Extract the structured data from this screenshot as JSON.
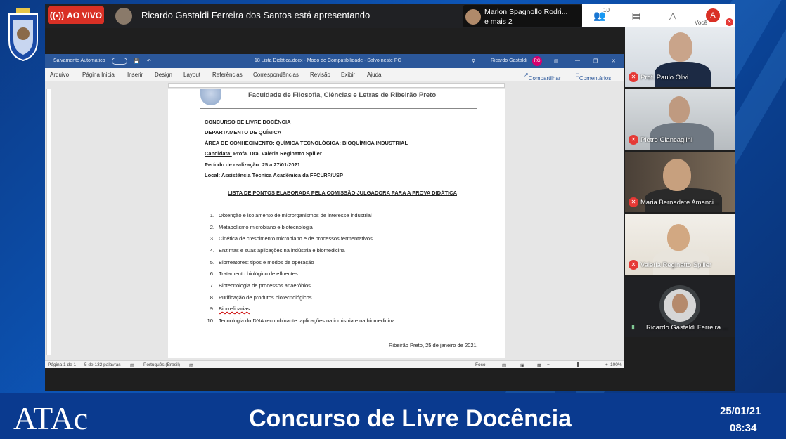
{
  "meet": {
    "live_badge": "AO VIVO",
    "presenter_text": "Ricardo Gastaldi Ferreira dos Santos está apresentando",
    "others_line1": "Marlon Spagnollo Rodri...",
    "others_line2": "e mais 2",
    "people_count": "10",
    "user_initial": "A",
    "you_label": "Você"
  },
  "word": {
    "autosave": "Salvamento Automático",
    "doc_title": "18 Lista Didática.docx  -  Modo de Compatibilidade  -  Salvo neste PC",
    "user_name": "Ricardo Gastaldi",
    "user_initials": "RG",
    "menu": [
      "Arquivo",
      "Página Inicial",
      "Inserir",
      "Design",
      "Layout",
      "Referências",
      "Correspondências",
      "Revisão",
      "Exibir",
      "Ajuda"
    ],
    "share": "Compartilhar",
    "comments": "Comentários",
    "status": {
      "page": "Página 1 de 1",
      "words": "5 de 132 palavras",
      "lang": "Português (Brasil)",
      "focus": "Foco",
      "zoom": "100%"
    }
  },
  "document": {
    "header": "Faculdade de Filosofia, Ciências e Letras de Ribeirão Preto",
    "lines": [
      "CONCURSO DE LIVRE DOCÊNCIA",
      "DEPARTAMENTO DE QUÍMICA",
      "ÁREA DE CONHECIMENTO: QUÍMICA TECNOLÓGICA: BIOQUÍMICA INDUSTRIAL"
    ],
    "candidate_label": "Candidata:",
    "candidate_value": "Profa. Dra. Valéria Reginatto Spiller",
    "period": "Período de realização: 25 a 27/01/2021",
    "place": "Local: Assistência Técnica Acadêmica da FFCLRP/USP",
    "list_title": "LISTA DE PONTOS ELABORADA PELA COMISSÃO JULGADORA PARA A PROVA DIDÁTICA",
    "items": [
      {
        "n": "1.",
        "t": "Obtenção e isolamento de microrganismos de interesse industrial"
      },
      {
        "n": "2.",
        "t": "Metabolismo microbiano e biotecnologia"
      },
      {
        "n": "3.",
        "t": "Cinética de crescimento microbiano e de processos fermentativos"
      },
      {
        "n": "4.",
        "t": "Enzimas e suas aplicações na indústria e biomedicina"
      },
      {
        "n": "5.",
        "t": "Biorreatores: tipos e modos de operação"
      },
      {
        "n": "6.",
        "t": "Tratamento biológico de efluentes"
      },
      {
        "n": "7.",
        "t": "Biotecnologia de processos anaeróbios"
      },
      {
        "n": "8.",
        "t": "Purificação de produtos biotecnológicos"
      },
      {
        "n": "9.",
        "t": "Biorrefinarias"
      },
      {
        "n": "10.",
        "t": "Tecnologia do DNA recombinante: aplicações na indústria e na biomedicina"
      }
    ],
    "signature": "Ribeirão Preto, 25 de janeiro de 2021."
  },
  "participants": [
    {
      "name": "Prof. Paulo Olivi"
    },
    {
      "name": "Pietro Ciancaglini"
    },
    {
      "name": "Maria Bernadete Amanci..."
    },
    {
      "name": "Valeria Reginatto Spiller"
    },
    {
      "name": "Ricardo Gastaldi Ferreira ..."
    }
  ],
  "banner": {
    "logo_text": "ATAc",
    "title": "Concurso de Livre Docência",
    "date": "25/01/21",
    "time": "08:34"
  },
  "colors": {
    "live": "#d93025",
    "word_blue": "#2b579a",
    "banner": "#0a3a8f"
  }
}
